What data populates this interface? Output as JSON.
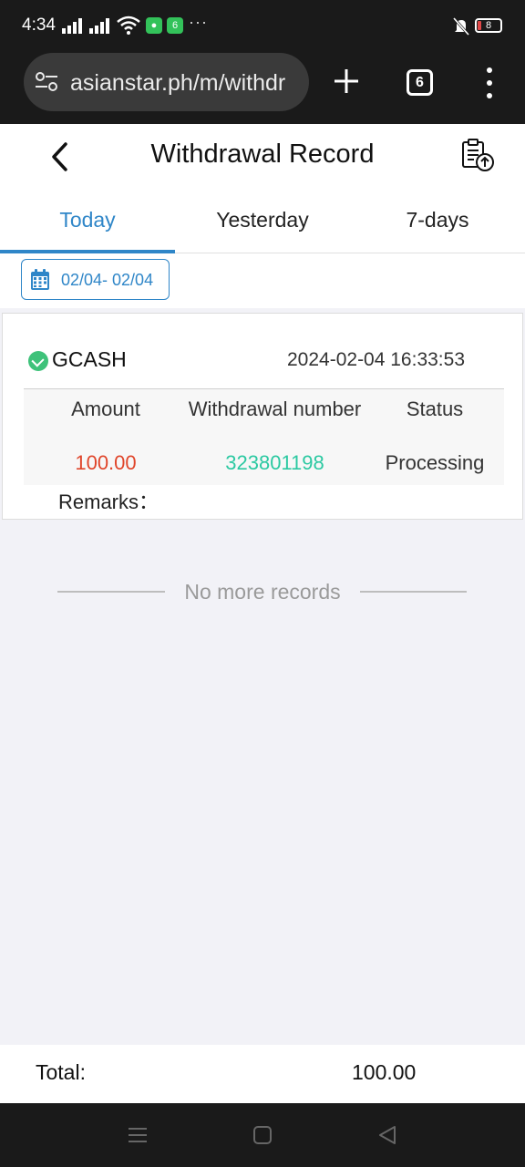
{
  "status_bar": {
    "time": "4:34",
    "app_badge_1": "●",
    "app_badge_2": "6",
    "more": "···",
    "battery": "8",
    "battery_level": 0.08
  },
  "browser": {
    "url": "asianstar.ph/m/withdr",
    "tab_count": "6"
  },
  "header": {
    "title": "Withdrawal Record"
  },
  "tabs": {
    "items": [
      {
        "label": "Today",
        "active": true
      },
      {
        "label": "Yesterday",
        "active": false
      },
      {
        "label": "7-days",
        "active": false
      }
    ]
  },
  "date_filter": {
    "range": "02/04- 02/04"
  },
  "record": {
    "method": "GCASH",
    "datetime": "2024-02-04 16:33:53",
    "columns": [
      "Amount",
      "Withdrawal number",
      "Status"
    ],
    "amount": "100.00",
    "withdrawal_number": "323801198",
    "status": "Processing",
    "remarks_label": "Remarks："
  },
  "list_end": {
    "text": "No more records"
  },
  "footer": {
    "total_label": "Total:",
    "total_value": "100.00"
  },
  "colors": {
    "accent": "#2f86c8",
    "amount": "#e0462b",
    "withdrawal_number": "#2cc9a2",
    "gcash": "#3ec27a"
  }
}
